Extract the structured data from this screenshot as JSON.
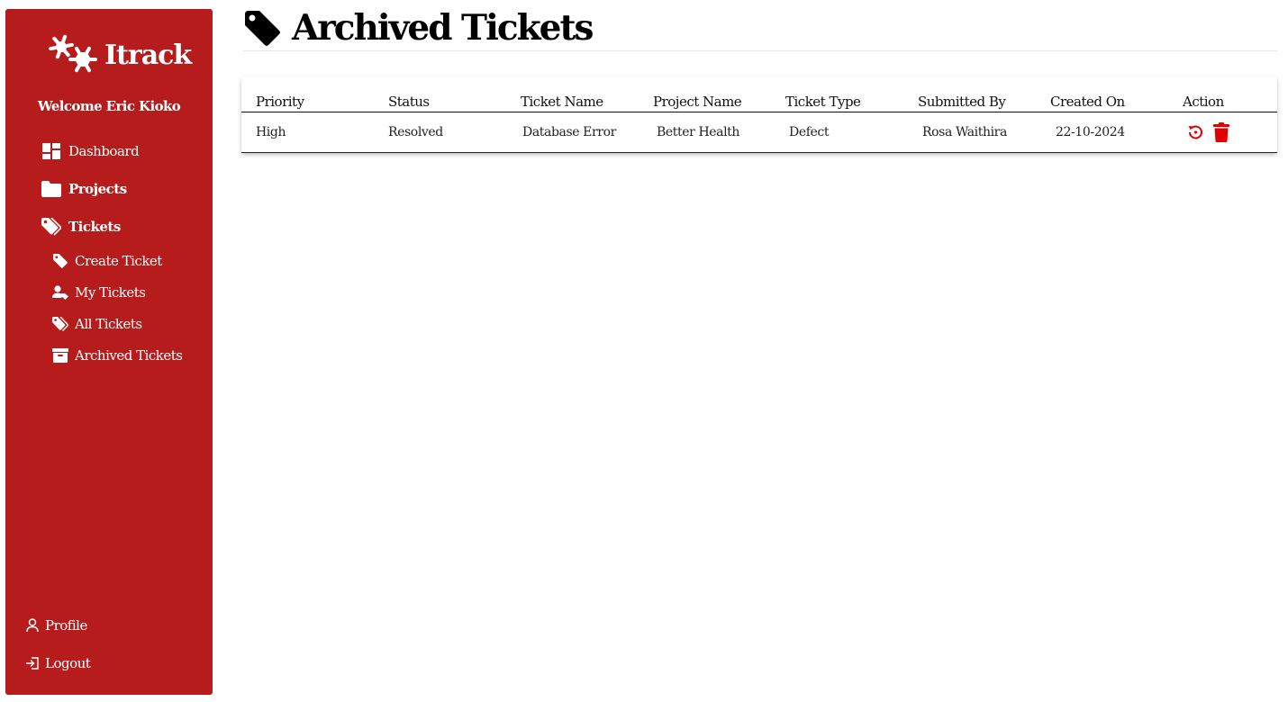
{
  "app": {
    "name": "Itrack"
  },
  "sidebar": {
    "welcome": "Welcome Eric Kioko",
    "nav": [
      {
        "label": "Dashboard",
        "icon": "dashboard-icon"
      },
      {
        "label": "Projects",
        "icon": "folder-icon"
      },
      {
        "label": "Tickets",
        "icon": "tags-icon"
      }
    ],
    "sub_items": [
      {
        "label": "Create Ticket",
        "icon": "tag-icon"
      },
      {
        "label": "My Tickets",
        "icon": "user-tag-icon"
      },
      {
        "label": "All Tickets",
        "icon": "tags-icon"
      },
      {
        "label": "Archived Tickets",
        "icon": "archive-icon"
      }
    ],
    "bottom": [
      {
        "label": "Profile",
        "icon": "user-icon"
      },
      {
        "label": "Logout",
        "icon": "logout-icon"
      }
    ]
  },
  "page": {
    "title": "Archived Tickets",
    "icon": "tag-icon"
  },
  "table": {
    "columns": [
      "Priority",
      "Status",
      "Ticket Name",
      "Project Name",
      "Ticket Type",
      "Submitted By",
      "Created On",
      "Action"
    ],
    "rows": [
      {
        "priority": "High",
        "status": "Resolved",
        "ticket_name": "Database Error",
        "project_name": "Better Health",
        "ticket_type": "Defect",
        "submitted_by": "Rosa Waithira",
        "created_on": "22-10-2024",
        "actions": [
          "restore-icon",
          "trash-icon"
        ]
      }
    ]
  },
  "colors": {
    "sidebar": "#b71c1c",
    "action_icon": "#e00000"
  }
}
